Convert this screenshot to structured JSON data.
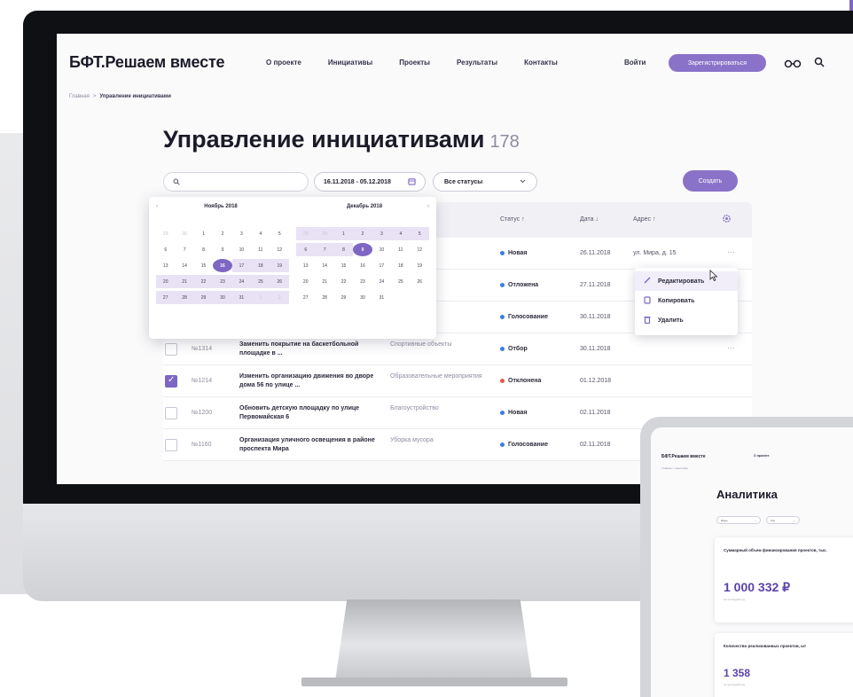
{
  "app": {
    "logo": "БФТ.Решаем вместе",
    "nav": [
      "О проекте",
      "Инициативы",
      "Проекты",
      "Результаты",
      "Контакты"
    ],
    "login": "Войти",
    "register": "Зарегистрироваться"
  },
  "breadcrumb": {
    "home": "Главная",
    "sep": ">",
    "current": "Управление инициативами"
  },
  "page": {
    "title": "Управление инициативами",
    "count": "178"
  },
  "filters": {
    "date_range": "16.11.2018 - 05.12.2018",
    "status": "Все статусы",
    "create": "Создать"
  },
  "table": {
    "headers": {
      "status": "Статус ↑",
      "date": "Дата ↓",
      "address": "Адрес ↑"
    },
    "rows": [
      {
        "checked": false,
        "id": "",
        "name": "",
        "category": "",
        "status": "Новая",
        "status_color": "#3d7fd9",
        "date": "26.11.2018",
        "address": "ул. Мира, д. 15",
        "more": "···"
      },
      {
        "checked": false,
        "id": "",
        "name": "",
        "category": "",
        "status": "Отложена",
        "status_color": "#3d7fd9",
        "date": "27.11.2018",
        "address": "",
        "more": ""
      },
      {
        "checked": false,
        "id": "",
        "name": "",
        "category": "",
        "status": "Голосование",
        "status_color": "#3d7fd9",
        "date": "30.11.2018",
        "address": "",
        "more": ""
      },
      {
        "checked": false,
        "id": "№1314",
        "name": "Заменить покрытие на баскетбольной площадке в ...",
        "category": "Спортивные объекты",
        "status": "Отбор",
        "status_color": "#3d7fd9",
        "date": "30.11.2018",
        "address": "",
        "more": "···"
      },
      {
        "checked": true,
        "id": "№1214",
        "name": "Изменить организацию движения во дворе дома 56 по улице ...",
        "category": "Образовательные мероприятия",
        "status": "Отклонена",
        "status_color": "#e8584f",
        "date": "01.12.2018",
        "address": "",
        "more": ""
      },
      {
        "checked": false,
        "id": "№1200",
        "name": "Обновить детскую площадку по улице Первомайская 6",
        "category": "Благоустройство",
        "status": "Новая",
        "status_color": "#3d7fd9",
        "date": "02.11.2018",
        "address": "",
        "more": ""
      },
      {
        "checked": false,
        "id": "№1160",
        "name": "Организация уличного освещения в районе проспекта Мира",
        "category": "Уборка мусора",
        "status": "Голосование",
        "status_color": "#3d7fd9",
        "date": "02.11.2018",
        "address": "",
        "more": ""
      }
    ]
  },
  "calendar": {
    "prev": "‹",
    "next": "›",
    "months": [
      {
        "title": "Ноябрь 2018",
        "days": [
          {
            "d": "29",
            "m": true
          },
          {
            "d": "30",
            "m": true
          },
          {
            "d": "1"
          },
          {
            "d": "2"
          },
          {
            "d": "3"
          },
          {
            "d": "4"
          },
          {
            "d": "5"
          },
          {
            "d": "6"
          },
          {
            "d": "7"
          },
          {
            "d": "8"
          },
          {
            "d": "9"
          },
          {
            "d": "10"
          },
          {
            "d": "11"
          },
          {
            "d": "12"
          },
          {
            "d": "13"
          },
          {
            "d": "14"
          },
          {
            "d": "15"
          },
          {
            "d": "16",
            "s": true
          },
          {
            "d": "17",
            "r": true
          },
          {
            "d": "18",
            "r": true
          },
          {
            "d": "19",
            "r": true
          },
          {
            "d": "20",
            "r": true
          },
          {
            "d": "21",
            "r": true
          },
          {
            "d": "22",
            "r": true
          },
          {
            "d": "23",
            "r": true
          },
          {
            "d": "24",
            "r": true
          },
          {
            "d": "25",
            "r": true
          },
          {
            "d": "26",
            "r": true
          },
          {
            "d": "27",
            "r": true
          },
          {
            "d": "28",
            "r": true
          },
          {
            "d": "29",
            "r": true
          },
          {
            "d": "30",
            "r": true
          },
          {
            "d": "31",
            "r": true
          },
          {
            "d": "1",
            "m": true,
            "r": true
          },
          {
            "d": "2",
            "m": true,
            "r": true
          }
        ]
      },
      {
        "title": "Декабрь 2018",
        "days": [
          {
            "d": "29",
            "m": true,
            "r": true
          },
          {
            "d": "30",
            "m": true,
            "r": true
          },
          {
            "d": "1",
            "r": true
          },
          {
            "d": "2",
            "r": true
          },
          {
            "d": "3",
            "r": true
          },
          {
            "d": "4",
            "r": true
          },
          {
            "d": "5",
            "r": true
          },
          {
            "d": "6",
            "r": true
          },
          {
            "d": "7",
            "r": true
          },
          {
            "d": "8",
            "r": true
          },
          {
            "d": "9",
            "s": true
          },
          {
            "d": "10"
          },
          {
            "d": "11"
          },
          {
            "d": "12"
          },
          {
            "d": "13"
          },
          {
            "d": "14"
          },
          {
            "d": "15"
          },
          {
            "d": "16"
          },
          {
            "d": "17"
          },
          {
            "d": "18"
          },
          {
            "d": "19"
          },
          {
            "d": "20"
          },
          {
            "d": "21"
          },
          {
            "d": "22"
          },
          {
            "d": "23"
          },
          {
            "d": "24"
          },
          {
            "d": "25"
          },
          {
            "d": "26"
          },
          {
            "d": "27"
          },
          {
            "d": "28"
          },
          {
            "d": "29"
          },
          {
            "d": "30"
          },
          {
            "d": "31"
          }
        ]
      }
    ]
  },
  "context_menu": {
    "edit": "Редактировать",
    "copy": "Копировать",
    "delete": "Удалить"
  },
  "laptop": {
    "logo": "БФТ.Решаем вместе",
    "nav": "О проекте",
    "breadcrumb": "Главная > Аналитика",
    "title": "Аналитика",
    "select1": "Июнь",
    "select2": "Год",
    "card1_label": "Суммарный объем финансирования проектов, тыс.",
    "card1_value": "1 000 332 ₽",
    "card1_sub": "за последний год",
    "card2_label": "Количество реализованных проектов, шт",
    "card2_value": "1 358",
    "card2_sub": "за последний год"
  },
  "colors": {
    "accent": "#8a72c9",
    "accent_dark": "#7d67c2",
    "range": "#e8e2f4"
  }
}
